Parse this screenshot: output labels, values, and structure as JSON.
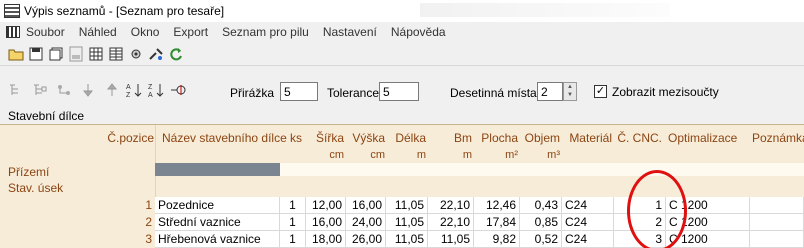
{
  "window": {
    "title": "Výpis seznamů - [Seznam pro tesaře]",
    "icon": "list-icon"
  },
  "menu": {
    "icon": "grid-icon",
    "items": [
      "Soubor",
      "Náhled",
      "Okno",
      "Export",
      "Seznam pro pilu",
      "Nastavení",
      "Nápověda"
    ]
  },
  "toolbar1": {
    "icons": [
      "open-folder-icon",
      "save-icon",
      "save-all-icon",
      "pdf-icon",
      "table-icon",
      "grid-view-icon",
      "settings-icon",
      "tools-icon",
      "refresh-icon"
    ]
  },
  "toolbar2": {
    "icons": [
      "expand-tree-icon",
      "collapse-tree-icon",
      "tree-icon",
      "arrow-down-icon",
      "arrow-up-icon",
      "sort-az-icon",
      "sort-za-icon",
      "pin-icon"
    ],
    "prirazka_label": "Přirážka",
    "prirazka_value": "5",
    "tolerance_label": "Tolerance",
    "tolerance_value": "5",
    "decimals_label": "Desetinná místa",
    "decimals_value": "2",
    "subtotals_label": "Zobrazit mezisoučty",
    "subtotals_checked": true
  },
  "section_title": "Stavební dílce",
  "table": {
    "headers": [
      "Č.pozice",
      "Název stavebního dílce",
      "ks",
      "Šířka",
      "Výška",
      "Délka",
      "Bm",
      "Plocha",
      "Objem",
      "Materiál",
      "Č. CNC.",
      "Optimalizace",
      "Poznámka"
    ],
    "units": [
      "",
      "",
      "",
      "cm",
      "cm",
      "m",
      "m",
      "m²",
      "m³",
      "",
      "",
      "",
      ""
    ],
    "groups": [
      "Přízemí",
      "Stav. úsek"
    ],
    "rows": [
      {
        "pos": "1",
        "name": "Pozednice",
        "ks": "1",
        "sirka": "12,00",
        "vyska": "16,00",
        "delka": "11,05",
        "bm": "22,10",
        "plocha": "12,46",
        "objem": "0,43",
        "material": "C24",
        "cnc": "1",
        "opt": "C 1200"
      },
      {
        "pos": "2",
        "name": "Střední vaznice",
        "ks": "1",
        "sirka": "16,00",
        "vyska": "24,00",
        "delka": "11,05",
        "bm": "22,10",
        "plocha": "17,84",
        "objem": "0,85",
        "material": "C24",
        "cnc": "2",
        "opt": "C 1200"
      },
      {
        "pos": "3",
        "name": "Hřebenová vaznice",
        "ks": "1",
        "sirka": "18,00",
        "vyska": "26,00",
        "delka": "11,05",
        "bm": "11,05",
        "plocha": "9,82",
        "objem": "0,52",
        "material": "C24",
        "cnc": "3",
        "opt": "C 1200"
      }
    ]
  },
  "colors": {
    "grid_bg": "#f7ecd8",
    "header_text": "#8b4513",
    "annotation": "#e01010"
  }
}
